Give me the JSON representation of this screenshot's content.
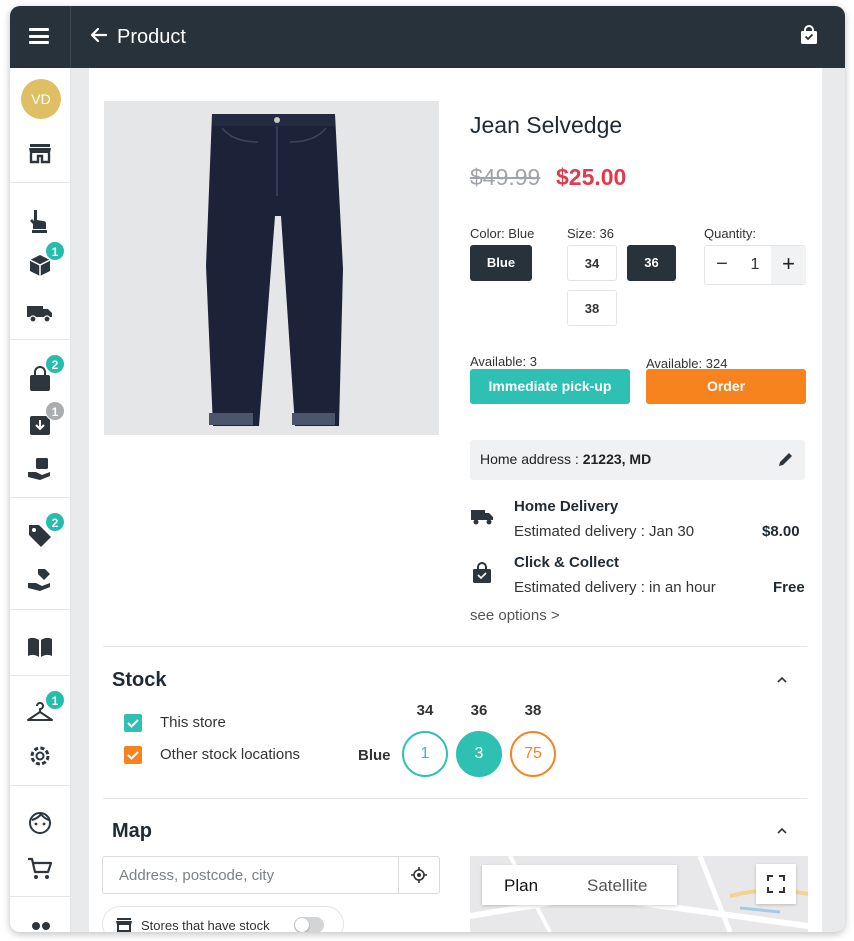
{
  "header": {
    "title": "Product"
  },
  "sidebar": {
    "avatar_initials": "VD",
    "badges": {
      "packages": "1",
      "shopping": "2",
      "returns": "1",
      "offers": "2",
      "hanger": "1"
    }
  },
  "product": {
    "name": "Jean Selvedge",
    "old_price": "$49.99",
    "new_price": "$25.00",
    "color_label": "Color: Blue",
    "color_option": "Blue",
    "size_label": "Size: 36",
    "sizes": [
      "34",
      "36",
      "38"
    ],
    "selected_size": "36",
    "quantity_label": "Quantity:",
    "quantity": "1"
  },
  "availability": {
    "pickup_available": "Available: 3",
    "pickup_button": "Immediate pick-up",
    "order_available": "Available: 324",
    "order_button": "Order"
  },
  "address": {
    "label": "Home address : ",
    "value": "21223, MD"
  },
  "delivery": [
    {
      "title": "Home Delivery",
      "subtitle": "Estimated delivery :  Jan 30",
      "price": "$8.00"
    },
    {
      "title": "Click & Collect",
      "subtitle": "Estimated delivery : in an hour",
      "price": "Free"
    }
  ],
  "see_options": "see options >",
  "stock": {
    "title": "Stock",
    "this_store": "This store",
    "other_locations": "Other stock locations",
    "row_label": "Blue",
    "sizes": [
      "34",
      "36",
      "38"
    ],
    "values": [
      "1",
      "3",
      "75"
    ]
  },
  "map": {
    "title": "Map",
    "search_placeholder": "Address, postcode, city",
    "stores_toggle_label": "Stores that have stock",
    "tab_plan": "Plan",
    "tab_satellite": "Satellite"
  },
  "colors": {
    "dark": "#27323a",
    "teal": "#2ec0b2",
    "orange": "#f7831e",
    "sale_red": "#e23a4d",
    "avatar": "#dfbf64"
  }
}
